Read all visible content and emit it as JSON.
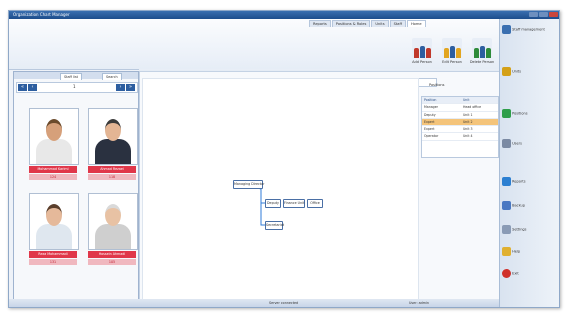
{
  "window": {
    "title": "Organization Chart Manager"
  },
  "ribbon": {
    "tabs": [
      "Home",
      "Staff",
      "Units",
      "Positions & Roles",
      "Reports"
    ],
    "active_tab": 0,
    "buttons": [
      {
        "label": "Add Person",
        "color": "#c0392b"
      },
      {
        "label": "Edit Person",
        "color": "#e2a520"
      },
      {
        "label": "Delete Person",
        "color": "#2e8b3a"
      }
    ]
  },
  "left_panel": {
    "tabs": [
      "Staff list",
      "Search"
    ],
    "page": "1",
    "people": [
      {
        "name": "Mohammad Karimi",
        "id": "124",
        "skin": "#d6a07a",
        "shirt": "#e8e8e8",
        "hair": "#6b4a2b"
      },
      {
        "name": "Ahmad Rezaei",
        "id": "118",
        "skin": "#e3b594",
        "shirt": "#2a3140",
        "hair": "#3a3a3a"
      },
      {
        "name": "Reza Mohammadi",
        "id": "131",
        "skin": "#e5b99a",
        "shirt": "#dfe7ef",
        "hair": "#5a3e2b"
      },
      {
        "name": "Hossein Ahmadi",
        "id": "105",
        "skin": "#e8c2a4",
        "shirt": "#cfcfcf",
        "hair": "#d9d9d9"
      }
    ]
  },
  "main": {
    "search_button": "Search",
    "nodes": [
      "Managing Director",
      "Deputy",
      "Finance Unit",
      "Office",
      "Secretariat"
    ]
  },
  "right_table": {
    "title": "Positions",
    "headers": [
      "Position",
      "Unit"
    ],
    "rows": [
      [
        "Manager",
        "Head office"
      ],
      [
        "Deputy",
        "Unit 1"
      ],
      [
        "Expert",
        "Unit 2"
      ],
      [
        "Expert",
        "Unit 3"
      ],
      [
        "Operator",
        "Unit 4"
      ]
    ],
    "selected_row": 2
  },
  "sidebar": {
    "items": [
      {
        "label": "Staff management",
        "color": "#3a6fb0"
      },
      {
        "label": "Units",
        "color": "#d4a017"
      },
      {
        "label": "Positions",
        "color": "#2e9e4a"
      },
      {
        "label": "Users",
        "color": "#7b8aa3"
      },
      {
        "label": "Reports",
        "color": "#2c7fd1"
      },
      {
        "label": "Backup",
        "color": "#4a78c2"
      },
      {
        "label": "Settings",
        "color": "#8a9bb5"
      },
      {
        "label": "Help",
        "color": "#e0b030"
      },
      {
        "label": "Exit",
        "color": "#d0302a"
      }
    ]
  },
  "status": {
    "left": "Server connected",
    "right": "User: admin"
  }
}
